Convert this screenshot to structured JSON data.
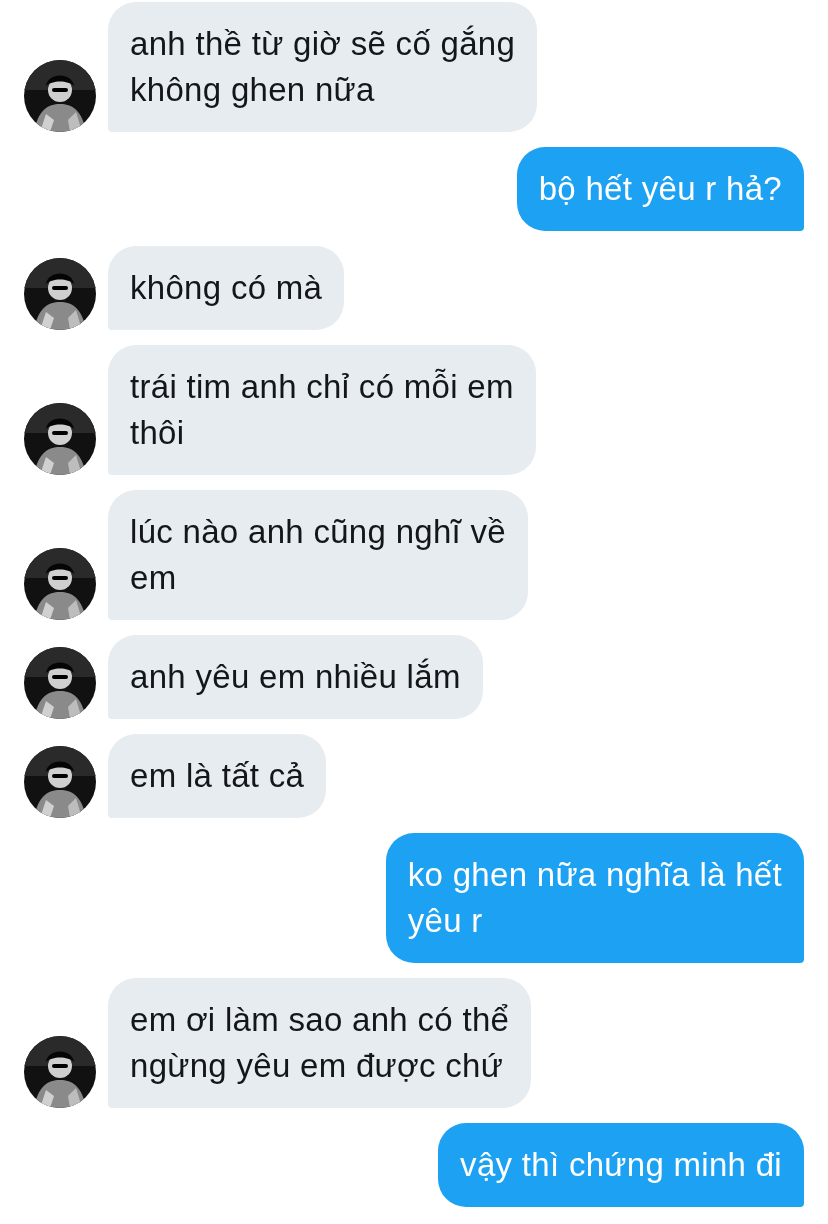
{
  "messages": [
    {
      "kind": "received",
      "text": "anh thề từ giờ sẽ cố gắng\nkhông ghen nữa"
    },
    {
      "kind": "sent",
      "text": "bộ hết yêu r hả?"
    },
    {
      "kind": "received",
      "text": "không có mà"
    },
    {
      "kind": "received",
      "text": "trái tim anh chỉ có mỗi em\nthôi"
    },
    {
      "kind": "received",
      "text": "lúc nào anh cũng nghĩ về\nem"
    },
    {
      "kind": "received",
      "text": "anh yêu em nhiều lắm"
    },
    {
      "kind": "received",
      "text": "em là tất cả"
    },
    {
      "kind": "sent",
      "text": "ko ghen nữa nghĩa là hết\nyêu r"
    },
    {
      "kind": "received",
      "text": "em ơi làm sao anh có thể\nngừng yêu em được chứ"
    },
    {
      "kind": "sent",
      "text": "vậy thì chứng minh đi"
    }
  ]
}
